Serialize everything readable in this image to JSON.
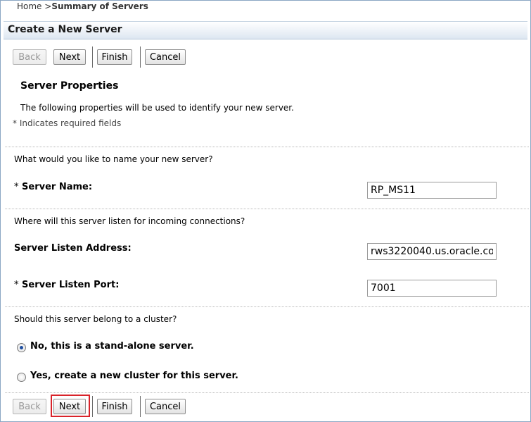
{
  "breadcrumb": {
    "home": "Home >",
    "current": "Summary of Servers"
  },
  "page_title": "Create a New Server",
  "toolbar": {
    "back": "Back",
    "next": "Next",
    "finish": "Finish",
    "cancel": "Cancel"
  },
  "section": {
    "heading": "Server Properties",
    "description": "The following properties will be used to identify your new server.",
    "required_note": "* Indicates required fields"
  },
  "name_question": "What would you like to name your new server?",
  "server_name": {
    "label": "Server Name:",
    "required_marker": "*",
    "value": "RP_MS11"
  },
  "listen_question": "Where will this server listen for incoming connections?",
  "listen_address": {
    "label": "Server Listen Address:",
    "value": "rws3220040.us.oracle.co"
  },
  "listen_port": {
    "label": "Server Listen Port:",
    "required_marker": "*",
    "value": "7001"
  },
  "cluster_question": "Should this server belong to a cluster?",
  "cluster_options": [
    {
      "label": "No, this is a stand-alone server.",
      "selected": true
    },
    {
      "label": "Yes, create a new cluster for this server.",
      "selected": false
    }
  ],
  "colors": {
    "highlight": "#d9232a",
    "radio_dot": "#1f4fa0",
    "title_gradient_end": "#dde7f1"
  }
}
